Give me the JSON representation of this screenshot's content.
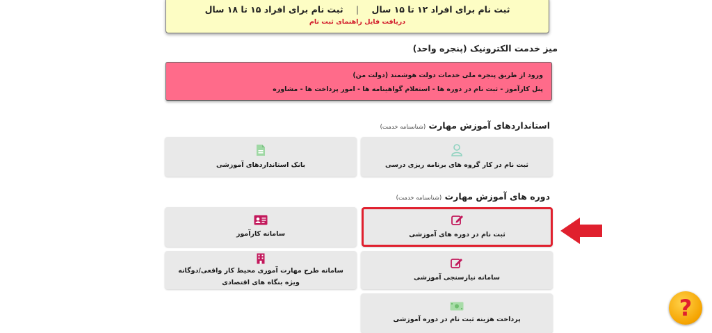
{
  "banner": {
    "reg_12_15": "ثبت نام برای افراد ۱۲ تا ۱۵ سال",
    "separator": "|",
    "reg_15_18": "ثبت نام برای افراد ۱۵ تا ۱۸ سال",
    "guide_link": "دریافت فایل راهنمای ثبت نام"
  },
  "eservice": {
    "title": "میز خدمت الکترونیک (پنجره واحد)",
    "panel_line1": "ورود از طریق پنجره ملی خدمات دولت هوشمند (دولت من)",
    "panel_line2": "پنل کارآموز - ثبت نام در دوره ها - استعلام گواهینامه ها - امور پرداخت ها - مشاوره"
  },
  "standards": {
    "title": "استانداردهای آموزش مهارت",
    "subtitle": "(شناسنامه خدمت)",
    "cards": [
      {
        "label": "ثبت نام در کار گروه های برنامه ریزی درسی",
        "icon": "user-icon"
      },
      {
        "label": "بانک استانداردهای آموزشی",
        "icon": "pdf-file-icon"
      }
    ]
  },
  "courses": {
    "title": "دوره های آموزش مهارت",
    "subtitle": "(شناسنامه خدمت)",
    "cards": [
      {
        "label": "ثبت نام در دوره های آموزشی",
        "icon": "edit-icon"
      },
      {
        "label": "سامانه کارآموز",
        "icon": "id-card-icon"
      },
      {
        "label": "سامانه نیازسنجی آموزشی",
        "icon": "edit-icon"
      },
      {
        "label_line1": "سامانه طرح مهارت آموزی محیط کار واقعی/دوگانه",
        "label_line2": "ویژه بنگاه های اقتصادی",
        "icon": "building-icon"
      },
      {
        "label": "پرداخت هزینه ثبت نام در دوره آموزشی",
        "icon": "money-icon"
      }
    ]
  },
  "help": {
    "symbol": "?",
    "icon": "help-icon"
  },
  "colors": {
    "accent_pink": "#c2185b",
    "highlight_red": "#e0202e",
    "banner_yellow": "#fdfdc4",
    "panel_pink": "#ff6b8a"
  }
}
